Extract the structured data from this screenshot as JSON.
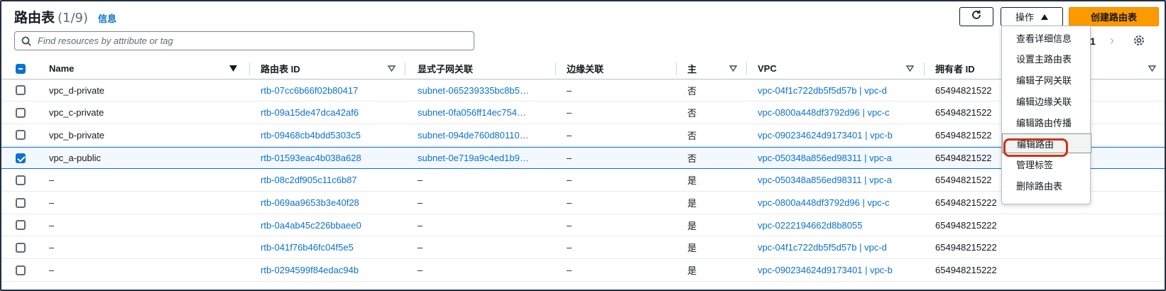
{
  "header": {
    "title": "路由表",
    "count": "(1/9)",
    "info_link": "信息"
  },
  "search": {
    "placeholder": "Find resources by attribute or tag"
  },
  "toolbar": {
    "actions_label": "操作",
    "create_label": "创建路由表"
  },
  "pagination": {
    "current_page": "1"
  },
  "columns": {
    "name": "Name",
    "route_table_id": "路由表 ID",
    "explicit_subnet": "显式子网关联",
    "edge": "边缘关联",
    "main": "主",
    "vpc": "VPC",
    "owner": "拥有者 ID"
  },
  "rows": [
    {
      "checked": false,
      "name": "vpc_d-private",
      "id": "rtb-07cc6b66f02b80417",
      "subnet": "subnet-065239335bc8b5…",
      "edge": "–",
      "main": "否",
      "vpc": "vpc-04f1c722db5f5d57b | vpc-d",
      "owner": "65494821522"
    },
    {
      "checked": false,
      "name": "vpc_c-private",
      "id": "rtb-09a15de47dca42af6",
      "subnet": "subnet-0fa056ff14ec754…",
      "edge": "–",
      "main": "否",
      "vpc": "vpc-0800a448df3792d96 | vpc-c",
      "owner": "65494821522"
    },
    {
      "checked": false,
      "name": "vpc_b-private",
      "id": "rtb-09468cb4bdd5303c5",
      "subnet": "subnet-094de760d80110…",
      "edge": "–",
      "main": "否",
      "vpc": "vpc-090234624d9173401 | vpc-b",
      "owner": "65494821522"
    },
    {
      "checked": true,
      "name": "vpc_a-public",
      "id": "rtb-01593eac4b038a628",
      "subnet": "subnet-0e719a9c4ed1b9…",
      "edge": "–",
      "main": "否",
      "vpc": "vpc-050348a856ed98311 | vpc-a",
      "owner": "65494821522"
    },
    {
      "checked": false,
      "name": "–",
      "id": "rtb-08c2df905c11c6b87",
      "subnet": "–",
      "edge": "–",
      "main": "是",
      "vpc": "vpc-050348a856ed98311 | vpc-a",
      "owner": "65494821522"
    },
    {
      "checked": false,
      "name": "–",
      "id": "rtb-069aa9653b3e40f28",
      "subnet": "–",
      "edge": "–",
      "main": "是",
      "vpc": "vpc-0800a448df3792d96 | vpc-c",
      "owner": "654948215222"
    },
    {
      "checked": false,
      "name": "–",
      "id": "rtb-0a4ab45c226bbaee0",
      "subnet": "–",
      "edge": "–",
      "main": "是",
      "vpc": "vpc-0222194662d8b8055",
      "owner": "654948215222"
    },
    {
      "checked": false,
      "name": "–",
      "id": "rtb-041f76b46fc04f5e5",
      "subnet": "–",
      "edge": "–",
      "main": "是",
      "vpc": "vpc-04f1c722db5f5d57b | vpc-d",
      "owner": "654948215222"
    },
    {
      "checked": false,
      "name": "–",
      "id": "rtb-0294599f84edac94b",
      "subnet": "–",
      "edge": "–",
      "main": "是",
      "vpc": "vpc-090234624d9173401 | vpc-b",
      "owner": "654948215222"
    }
  ],
  "menu": {
    "items": [
      "查看详细信息",
      "设置主路由表",
      "编辑子网关联",
      "编辑边缘关联",
      "编辑路由传播",
      "编辑路由",
      "管理标签",
      "删除路由表"
    ],
    "highlighted_index": 5
  },
  "colors": {
    "link": "#0972d3",
    "primary_button": "#ff9900",
    "highlight_ring": "#d13212"
  }
}
